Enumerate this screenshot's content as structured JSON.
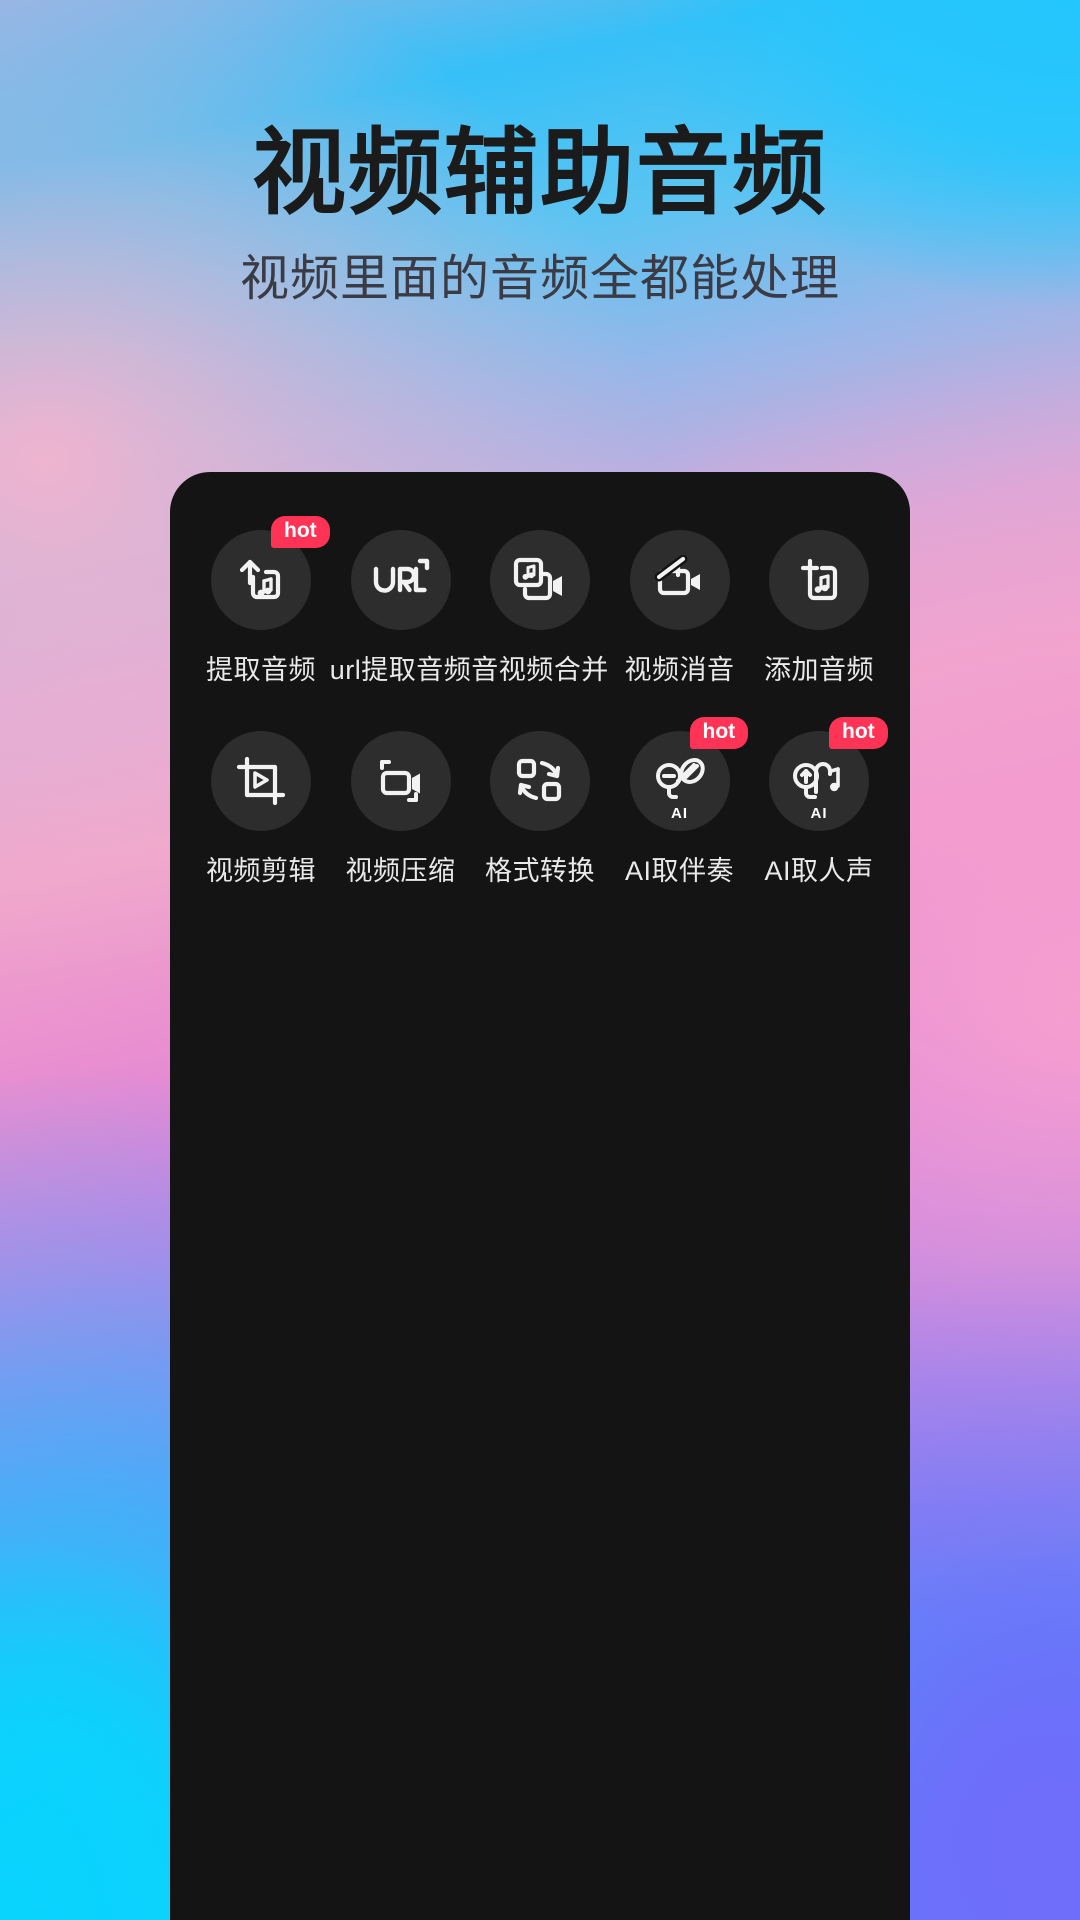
{
  "header": {
    "title": "视频辅助音频",
    "subtitle": "视频里面的音频全都能处理"
  },
  "colors": {
    "hot_badge": "#ff3355",
    "card_background": "#141414",
    "icon_circle": "#2d2d2d",
    "label_text": "#e9e9e9",
    "title_text": "#1b1b1b"
  },
  "grid": {
    "rows": [
      {
        "items": [
          {
            "label": "提取音频",
            "icon": "extract-audio-icon",
            "badge": "hot",
            "ai": ""
          },
          {
            "label": "url提取音频",
            "icon": "url-icon",
            "badge": "",
            "ai": ""
          },
          {
            "label": "音视频合并",
            "icon": "merge-audio-video-icon",
            "badge": "",
            "ai": ""
          },
          {
            "label": "视频消音",
            "icon": "mute-video-icon",
            "badge": "",
            "ai": ""
          },
          {
            "label": "添加音频",
            "icon": "add-audio-icon",
            "badge": "",
            "ai": ""
          }
        ]
      },
      {
        "items": [
          {
            "label": "视频剪辑",
            "icon": "video-crop-icon",
            "badge": "",
            "ai": ""
          },
          {
            "label": "视频压缩",
            "icon": "video-compress-icon",
            "badge": "",
            "ai": ""
          },
          {
            "label": "格式转换",
            "icon": "format-convert-icon",
            "badge": "",
            "ai": ""
          },
          {
            "label": "AI取伴奏",
            "icon": "ai-instrumental-icon",
            "badge": "hot",
            "ai": "AI"
          },
          {
            "label": "AI取人声",
            "icon": "ai-vocal-icon",
            "badge": "hot",
            "ai": "AI"
          }
        ]
      }
    ]
  }
}
